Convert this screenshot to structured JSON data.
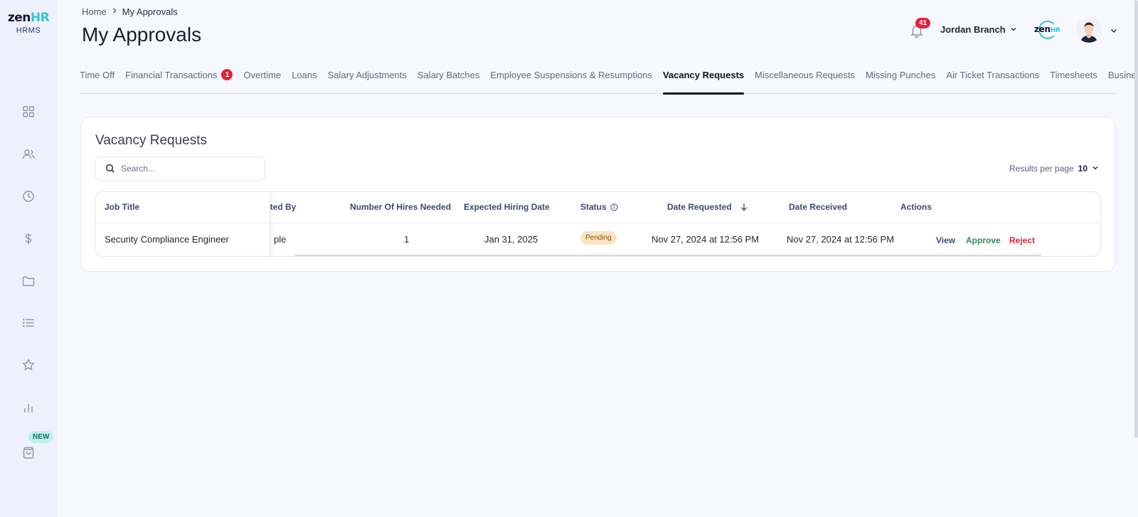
{
  "logo": {
    "text_main": "zen",
    "text_accent": "HR",
    "subtitle": "HRMS"
  },
  "sidebar": {
    "items": [
      {
        "icon": "dashboard-icon"
      },
      {
        "icon": "users-icon"
      },
      {
        "icon": "clock-icon"
      },
      {
        "icon": "dollar-icon"
      },
      {
        "icon": "folder-icon"
      },
      {
        "icon": "list-icon"
      },
      {
        "icon": "star-icon"
      },
      {
        "icon": "bar-chart-icon"
      },
      {
        "icon": "bag-icon"
      }
    ],
    "new_badge": "NEW"
  },
  "breadcrumb": {
    "home": "Home",
    "current": "My Approvals"
  },
  "page_title": "My Approvals",
  "header": {
    "notification_count": "41",
    "user_name": "Jordan Branch",
    "brand_main": "zen",
    "brand_accent": "HR"
  },
  "tabs": [
    {
      "label": "Time Off"
    },
    {
      "label": "Financial Transactions",
      "badge": "1"
    },
    {
      "label": "Overtime"
    },
    {
      "label": "Loans"
    },
    {
      "label": "Salary Adjustments"
    },
    {
      "label": "Salary Batches"
    },
    {
      "label": "Employee Suspensions & Resumptions"
    },
    {
      "label": "Vacancy Requests",
      "active": true
    },
    {
      "label": "Miscellaneous Requests"
    },
    {
      "label": "Missing Punches"
    },
    {
      "label": "Air Ticket Transactions"
    },
    {
      "label": "Timesheets"
    },
    {
      "label": "Business Trips"
    }
  ],
  "card": {
    "title": "Vacancy Requests",
    "search_placeholder": "Search...",
    "results_per_page_label": "Results per page",
    "results_per_page_value": "10"
  },
  "table": {
    "headers": {
      "job_title": "Job Title",
      "requested_by": "sted By",
      "hires_needed": "Number Of Hires Needed",
      "expected_hiring_date": "Expected Hiring Date",
      "status": "Status",
      "date_requested": "Date Requested",
      "date_received": "Date Received",
      "actions": "Actions"
    },
    "rows": [
      {
        "job_title": "Security Compliance Engineer",
        "requested_by": "ple",
        "hires_needed": "1",
        "expected_hiring_date": "Jan 31, 2025",
        "status": "Pending",
        "date_requested": "Nov 27, 2024 at 12:56 PM",
        "date_received": "Nov 27, 2024 at 12:56 PM",
        "actions": {
          "view": "View",
          "approve": "Approve",
          "reject": "Reject"
        }
      }
    ]
  },
  "colors": {
    "accent": "#2fc7cf",
    "badge_red": "#e0233a",
    "pending_bg": "#fbe3c2",
    "approve": "#2e8b57",
    "reject": "#d3283c"
  }
}
